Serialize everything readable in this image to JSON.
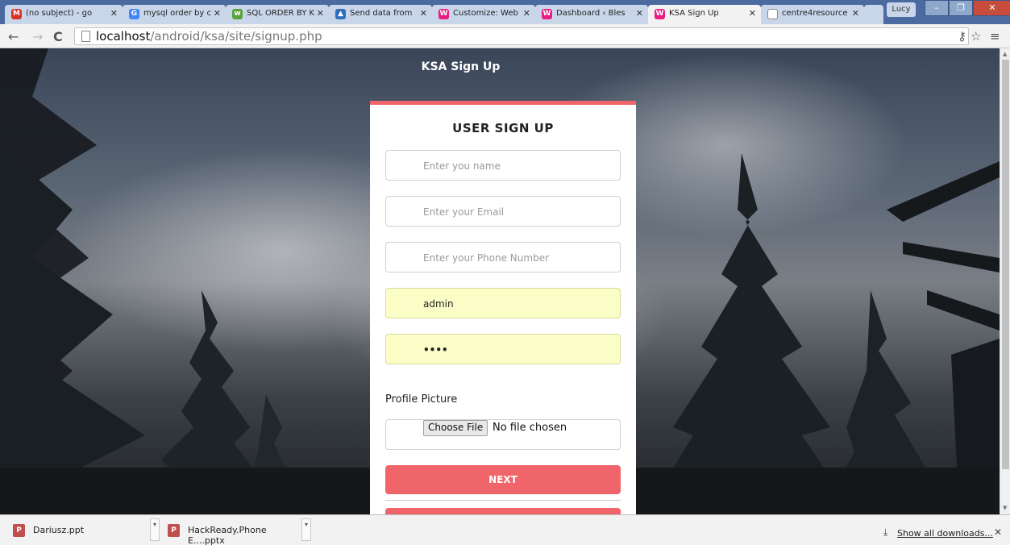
{
  "browser": {
    "tabs": [
      {
        "label": "(no subject) - go",
        "favicon": "gmail-icon"
      },
      {
        "label": "mysql order by c",
        "favicon": "google-icon"
      },
      {
        "label": "SQL ORDER BY K",
        "favicon": "w3schools-icon"
      },
      {
        "label": "Send data from",
        "favicon": "bird-icon"
      },
      {
        "label": "Customize: Web",
        "favicon": "wordpress-icon"
      },
      {
        "label": "Dashboard ‹ Bles",
        "favicon": "wordpress-icon"
      },
      {
        "label": "KSA Sign Up",
        "favicon": "wordpress-icon"
      },
      {
        "label": "centre4resource",
        "favicon": "page-icon"
      }
    ],
    "user_label": "Lucy",
    "url_host": "localhost",
    "url_path": "/android/ksa/site/signup.php"
  },
  "page": {
    "header_title": "KSA Sign Up",
    "form_title": "USER SIGN UP",
    "name_placeholder": "Enter you name",
    "email_placeholder": "Enter your Email",
    "phone_placeholder": "Enter your Phone Number",
    "username_value": "admin",
    "password_value": "••••",
    "profile_label": "Profile Picture",
    "choose_file_label": "Choose File",
    "file_status": "No file chosen",
    "next_label": "NEXT"
  },
  "downloads": {
    "items": [
      {
        "name": "Dariusz.ppt"
      },
      {
        "name": "HackReady.Phone E....pptx"
      }
    ],
    "show_all": "Show all downloads..."
  },
  "colors": {
    "accent": "#f0656a",
    "autofill": "#fafdc6"
  }
}
